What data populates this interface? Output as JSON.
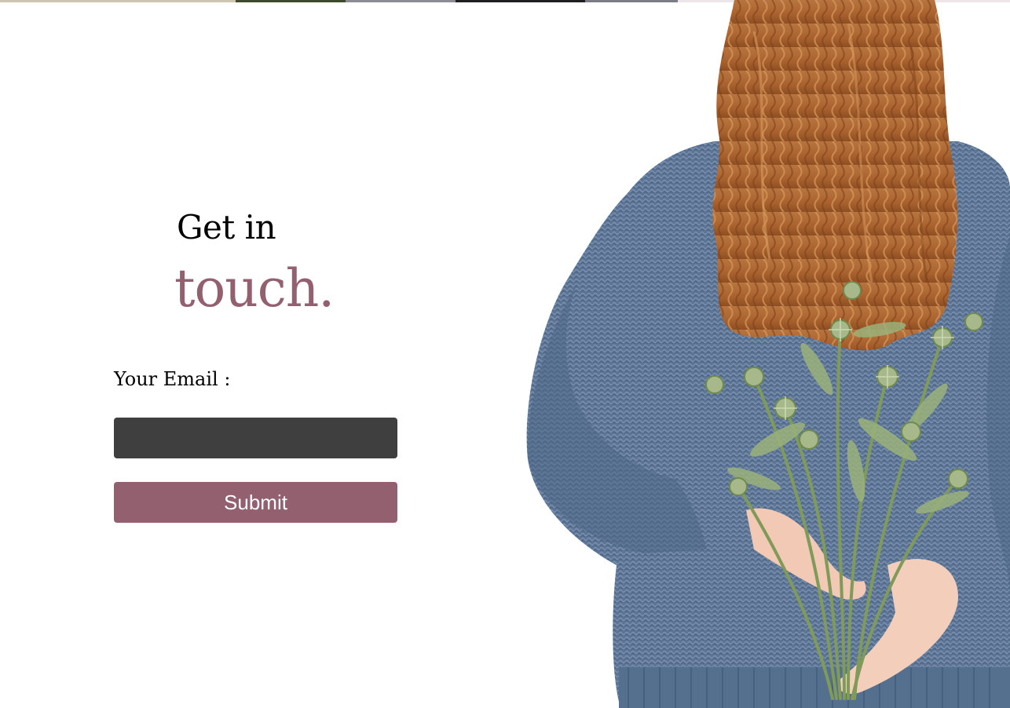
{
  "heading": {
    "line1": "Get in",
    "line2": "touch."
  },
  "form": {
    "email_label": "Your Email :",
    "email_value": "",
    "email_placeholder": "",
    "submit_label": "Submit"
  },
  "colors": {
    "accent": "#936070",
    "input_bg": "#3f3f3f",
    "heading_text": "#000000",
    "page_bg": "#ffffff"
  },
  "image": {
    "icon": "woman-holding-thistle-bouquet-photo"
  }
}
